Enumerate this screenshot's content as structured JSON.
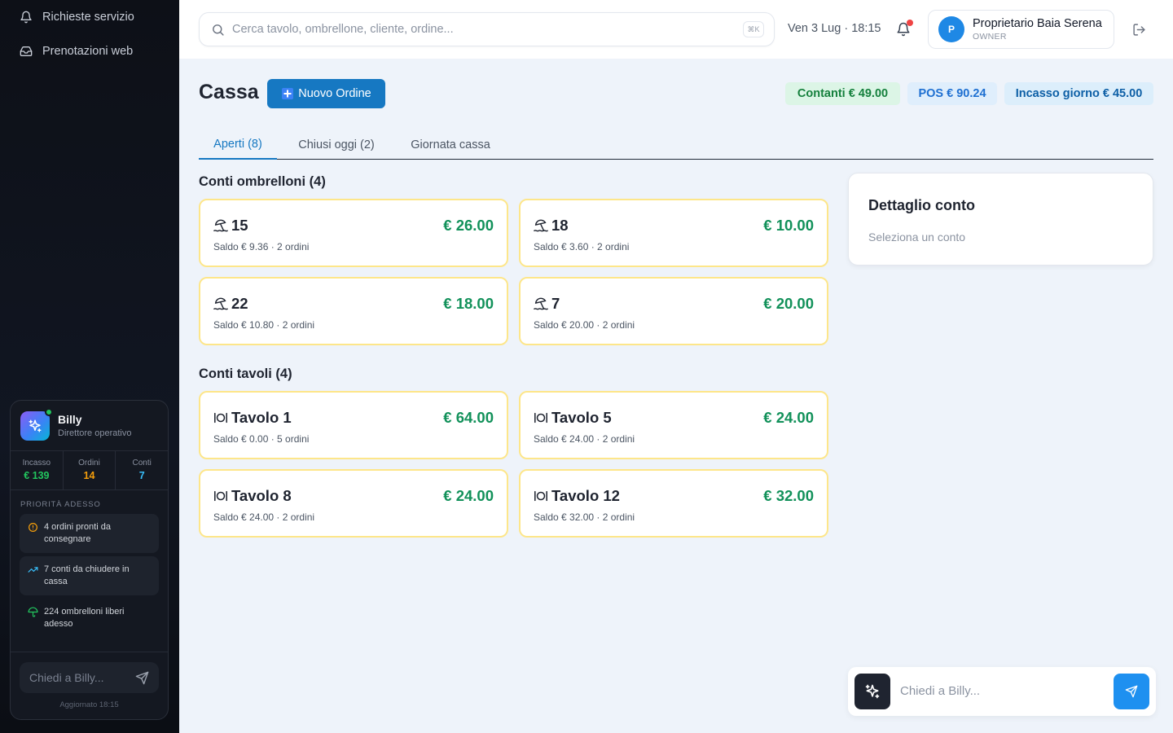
{
  "sidebar": {
    "items": [
      {
        "label": "Richieste servizio",
        "icon": "bell-icon"
      },
      {
        "label": "Prenotazioni web",
        "icon": "inbox-icon"
      }
    ],
    "assistant": {
      "name": "Billy",
      "role": "Direttore operativo",
      "stats": [
        {
          "label": "Incasso",
          "value": "€ 139",
          "color": "#22c55e"
        },
        {
          "label": "Ordini",
          "value": "14",
          "color": "#f59e0b"
        },
        {
          "label": "Conti",
          "value": "7",
          "color": "#38bdf8"
        }
      ],
      "priority_title": "PRIORITÀ ADESSO",
      "priorities": [
        {
          "text": "4 ordini pronti da consegnare",
          "icon": "alert-circle-icon",
          "color": "#f59e0b"
        },
        {
          "text": "7 conti da chiudere in cassa",
          "icon": "trending-up-icon",
          "color": "#38bdf8"
        },
        {
          "text": "224 ombrelloni liberi adesso",
          "icon": "umbrella-icon",
          "color": "#22c55e"
        }
      ],
      "input_placeholder": "Chiedi a Billy...",
      "updated": "Aggiornato 18:15"
    }
  },
  "topbar": {
    "search_placeholder": "Cerca tavolo, ombrellone, cliente, ordine...",
    "shortcut": "⌘K",
    "date": "Ven 3 Lug · 18:15",
    "user": {
      "initial": "P",
      "name": "Proprietario Baia Serena",
      "role": "OWNER"
    }
  },
  "main": {
    "title": "Cassa",
    "new_order_label": "Nuovo Ordine",
    "chips": {
      "cash": "Contanti € 49.00",
      "pos": "POS € 90.24",
      "day": "Incasso giorno € 45.00"
    },
    "tabs": [
      "Aperti (8)",
      "Chiusi oggi (2)",
      "Giornata cassa"
    ],
    "umbrellas_title": "Conti ombrelloni (4)",
    "umbrellas": [
      {
        "name": "15",
        "amount": "€ 26.00",
        "sub": "Saldo € 9.36 · 2 ordini"
      },
      {
        "name": "18",
        "amount": "€ 10.00",
        "sub": "Saldo € 3.60 · 2 ordini"
      },
      {
        "name": "22",
        "amount": "€ 18.00",
        "sub": "Saldo € 10.80 · 2 ordini"
      },
      {
        "name": "7",
        "amount": "€ 20.00",
        "sub": "Saldo € 20.00 · 2 ordini"
      }
    ],
    "tables_title": "Conti tavoli (4)",
    "tables": [
      {
        "name": "Tavolo 1",
        "amount": "€ 64.00",
        "sub": "Saldo € 0.00 · 5 ordini"
      },
      {
        "name": "Tavolo 5",
        "amount": "€ 24.00",
        "sub": "Saldo € 24.00 · 2 ordini"
      },
      {
        "name": "Tavolo 8",
        "amount": "€ 24.00",
        "sub": "Saldo € 24.00 · 2 ordini"
      },
      {
        "name": "Tavolo 12",
        "amount": "€ 32.00",
        "sub": "Saldo € 32.00 · 2 ordini"
      }
    ],
    "detail": {
      "title": "Dettaglio conto",
      "placeholder": "Seleziona un conto"
    },
    "ask": {
      "placeholder": "Chiedi a Billy..."
    }
  }
}
